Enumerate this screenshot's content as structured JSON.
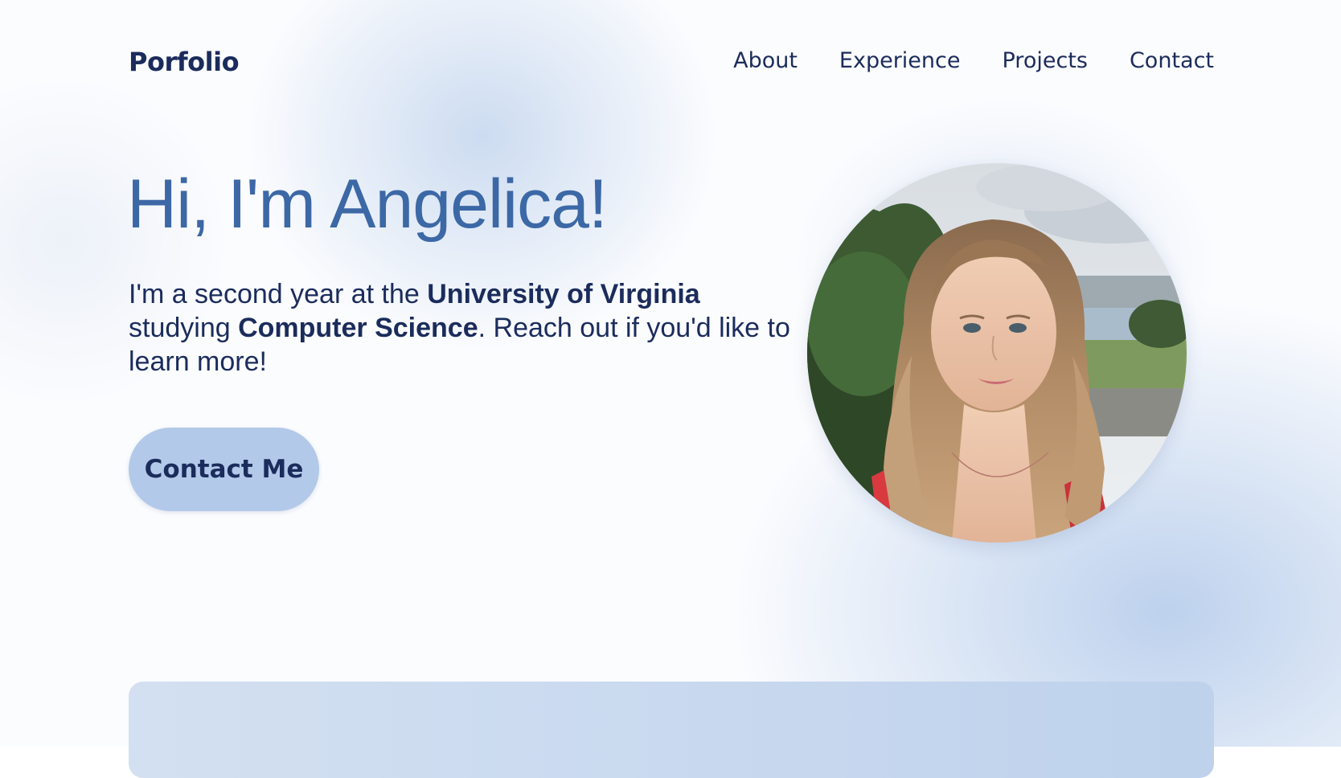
{
  "nav": {
    "brand": "Porfolio",
    "links": [
      {
        "label": "About"
      },
      {
        "label": "Experience"
      },
      {
        "label": "Projects"
      },
      {
        "label": "Contact"
      }
    ]
  },
  "hero": {
    "title": "Hi, I'm Angelica!",
    "text_part1": "I'm a second year at the ",
    "university": "University of Virginia",
    "text_part2": " studying ",
    "major": "Computer Science",
    "text_part3": ". Reach out if you'd like to learn more!",
    "button_label": "Contact Me",
    "photo_icon": "profile-photo"
  },
  "colors": {
    "title": "#3c68a6",
    "text": "#1b2c5c",
    "button_bg": "#b2c9e9",
    "panel": "#c9d9ef"
  }
}
